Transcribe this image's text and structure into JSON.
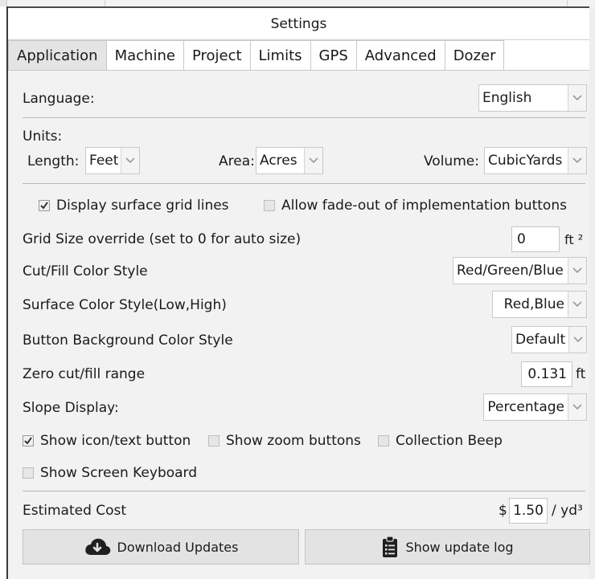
{
  "window": {
    "title": "Settings"
  },
  "tabs": [
    {
      "label": "Application",
      "active": true
    },
    {
      "label": "Machine"
    },
    {
      "label": "Project"
    },
    {
      "label": "Limits"
    },
    {
      "label": "GPS"
    },
    {
      "label": "Advanced"
    },
    {
      "label": "Dozer"
    }
  ],
  "language": {
    "label": "Language:",
    "value": "English"
  },
  "units": {
    "label": "Units:",
    "length_label": "Length:",
    "length_value": "Feet",
    "area_label": "Area:",
    "area_value": "Acres",
    "volume_label": "Volume:",
    "volume_value": "CubicYards"
  },
  "options": {
    "display_grid": {
      "label": "Display surface grid lines",
      "checked": true
    },
    "fade_out": {
      "label": "Allow fade-out of implementation buttons",
      "checked": false
    }
  },
  "grid_size": {
    "label": "Grid Size override (set to 0 for auto size)",
    "value": "0",
    "unit": "ft ²"
  },
  "cut_fill_style": {
    "label": "Cut/Fill Color Style",
    "value": "Red/Green/Blue"
  },
  "surface_style": {
    "label": "Surface Color Style(Low,High)",
    "value": "Red,Blue"
  },
  "button_bg_style": {
    "label": "Button Background Color Style",
    "value": "Default"
  },
  "zero_range": {
    "label": "Zero cut/fill range",
    "value": "0.131",
    "unit": "ft"
  },
  "slope": {
    "label": "Slope Display:",
    "value": "Percentage"
  },
  "checkboxes2": {
    "show_icon_text": {
      "label": "Show icon/text button",
      "checked": true
    },
    "show_zoom": {
      "label": "Show zoom buttons",
      "checked": false
    },
    "collection_beep": {
      "label": "Collection Beep",
      "checked": false
    },
    "screen_keyboard": {
      "label": "Show Screen Keyboard",
      "checked": false
    }
  },
  "cost": {
    "label": "Estimated Cost",
    "currency": "$",
    "value": "1.50",
    "unit": "/ yd³"
  },
  "buttons": {
    "download": "Download Updates",
    "log": "Show update log"
  },
  "icons": {
    "dropdown": "chevron-down-icon",
    "download": "cloud-download-icon",
    "log": "clipboard-list-icon",
    "check": "checkmark-icon"
  }
}
